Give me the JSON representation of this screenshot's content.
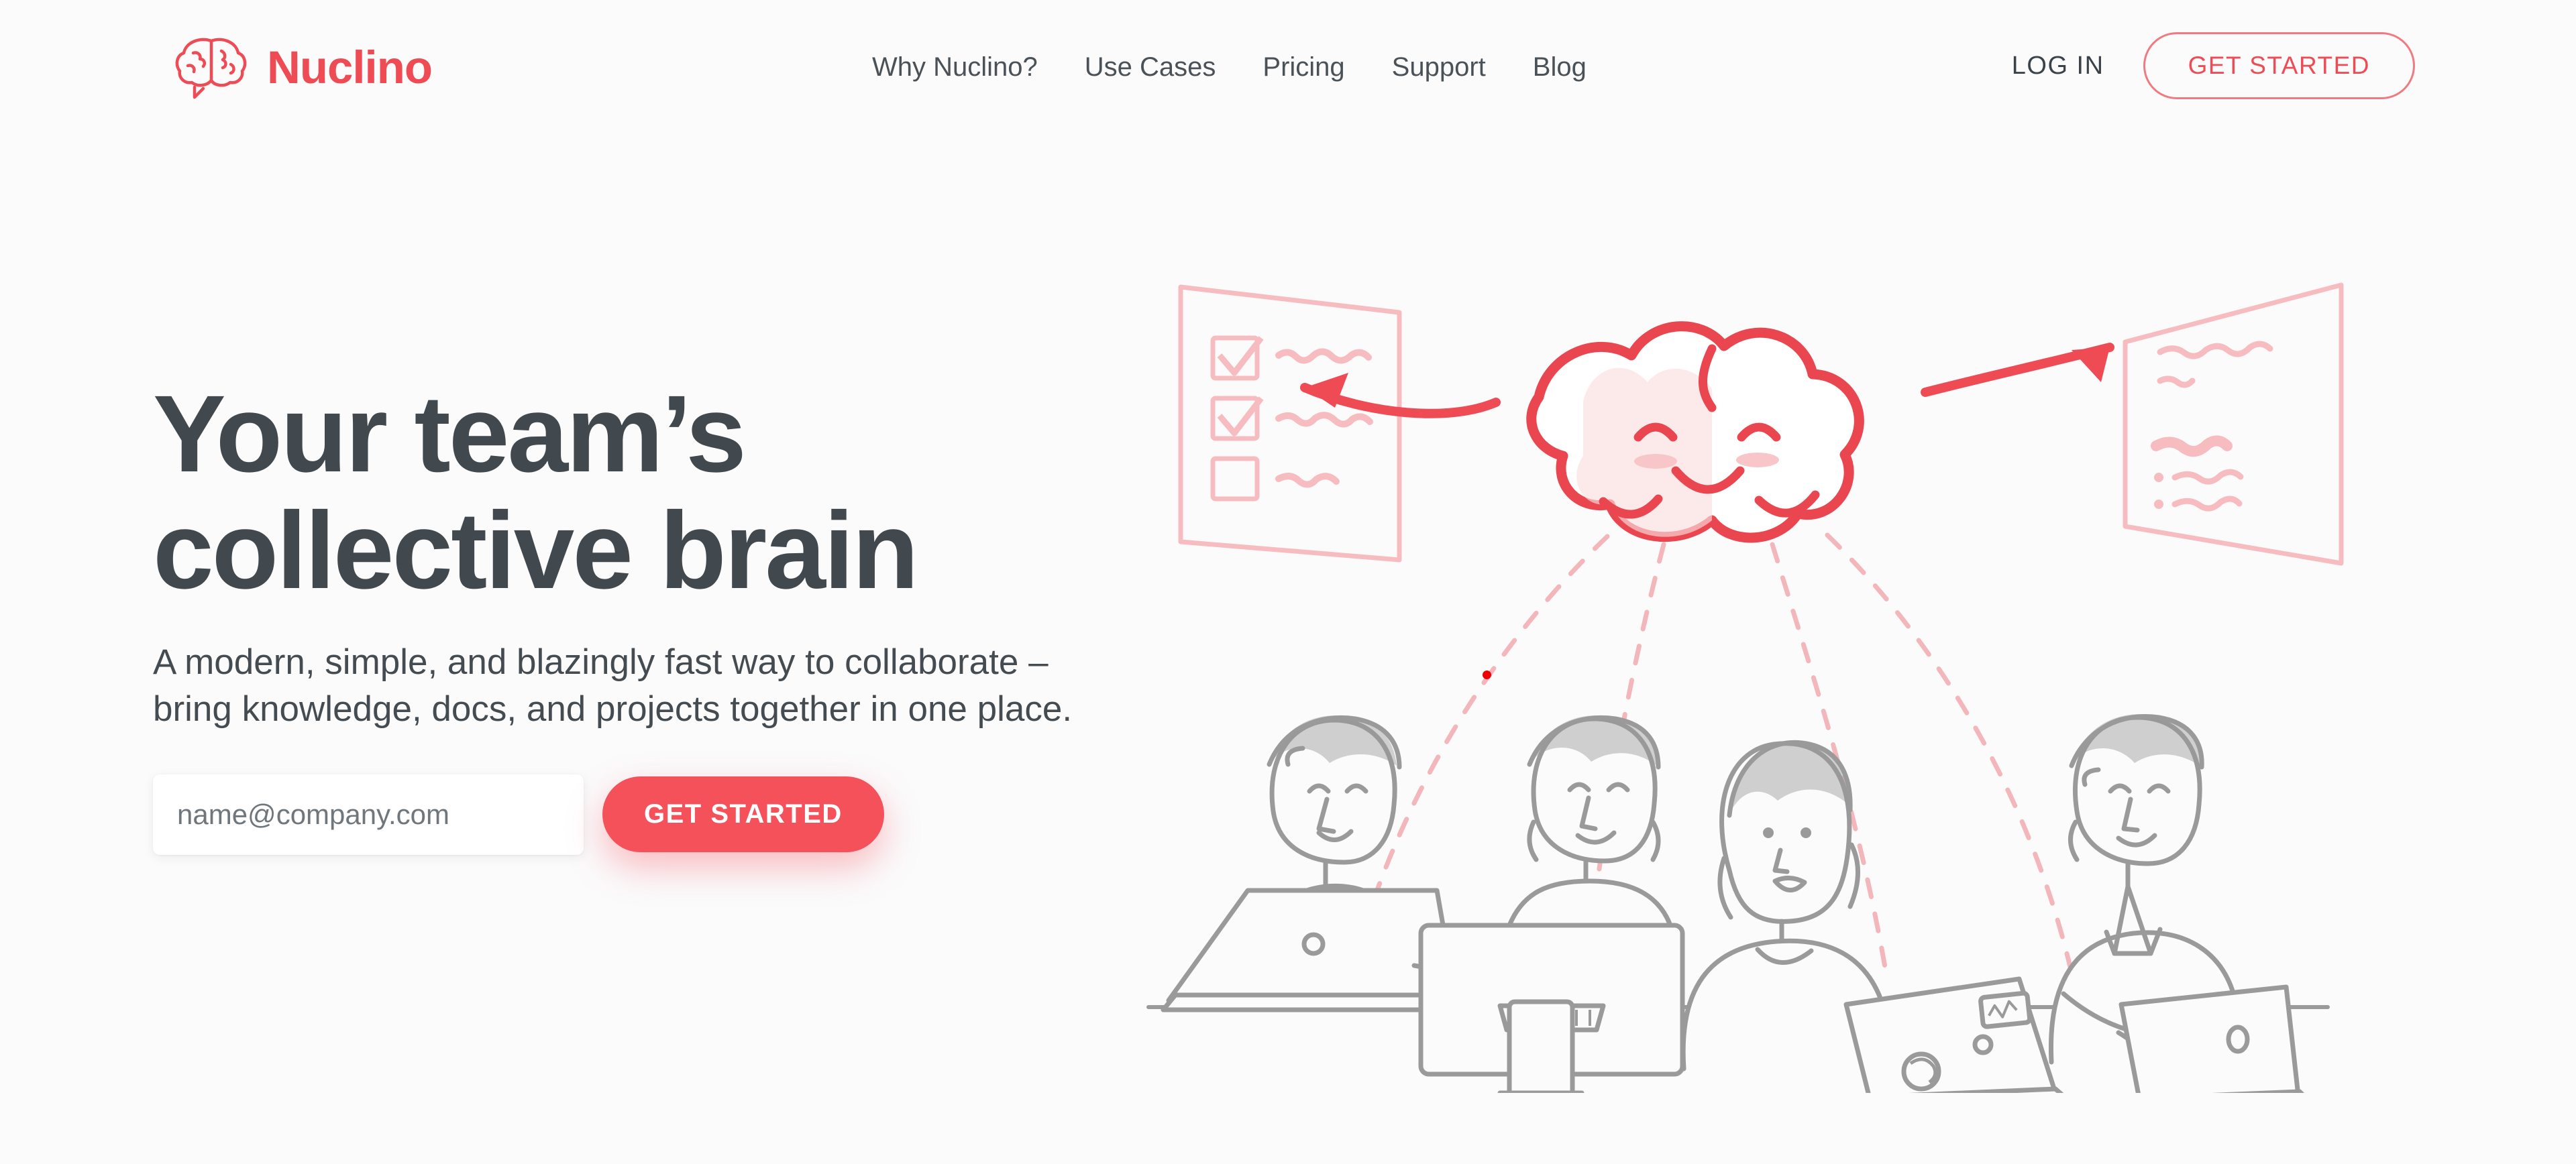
{
  "brand": {
    "name": "Nuclino",
    "logo_icon": "brain-speech-bubble-icon",
    "color": "#ef4b55"
  },
  "nav": {
    "items": [
      {
        "label": "Why Nuclino?"
      },
      {
        "label": "Use Cases"
      },
      {
        "label": "Pricing"
      },
      {
        "label": "Support"
      },
      {
        "label": "Blog"
      }
    ]
  },
  "header_actions": {
    "login_label": "LOG IN",
    "get_started_label": "GET STARTED"
  },
  "hero": {
    "headline_line1": "Your team’s",
    "headline_line2": "collective brain",
    "subhead_line1": "A modern, simple, and blazingly fast way to collaborate –",
    "subhead_line2": "bring knowledge, docs, and projects together in one place.",
    "email_placeholder": "name@company.com",
    "email_value": "",
    "cta_label": "GET STARTED"
  },
  "illustration": {
    "description": "Smiling cloud-brain connected by red arrows to a checklist board and a whiteboard, with four people working on laptops below connected by dashed arcs",
    "cloud_icon": "smiling-cloud-brain-icon",
    "left_board_icon": "checklist-board-icon",
    "right_board_icon": "whiteboard-icon",
    "people_count": 4,
    "accent_color": "#ef4b55",
    "line_color": "#9a9a9a",
    "dash_color": "#f3b7bb"
  },
  "colors": {
    "background": "#fbfbfc",
    "headline": "#41484e",
    "accent": "#ef4b55",
    "cta_solid": "#f4515b",
    "nav_text": "#4a5258"
  }
}
